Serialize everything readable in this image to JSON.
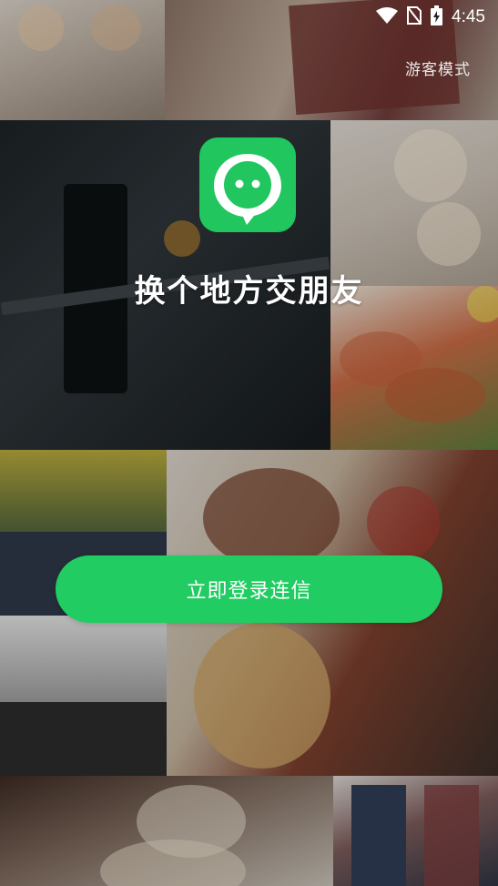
{
  "status_bar": {
    "time": "4:45",
    "icons": [
      "wifi-icon",
      "sim-icon",
      "battery-charging-icon"
    ]
  },
  "header": {
    "guest_mode_label": "游客模式"
  },
  "brand": {
    "logo_icon": "chat-bubble-face-icon",
    "slogan": "换个地方交朋友",
    "accent_color": "#21cc62"
  },
  "actions": {
    "login_label": "立即登录连信"
  },
  "background": {
    "tiles": [
      "photo-figurines",
      "photo-rug",
      "photo-gym-barbell",
      "photo-pistachio-flowers",
      "photo-salmon-dish",
      "photo-autumn-road",
      "photo-reindeer-ornament",
      "photo-railway-street",
      "photo-coffee-table",
      "photo-people-street"
    ]
  }
}
